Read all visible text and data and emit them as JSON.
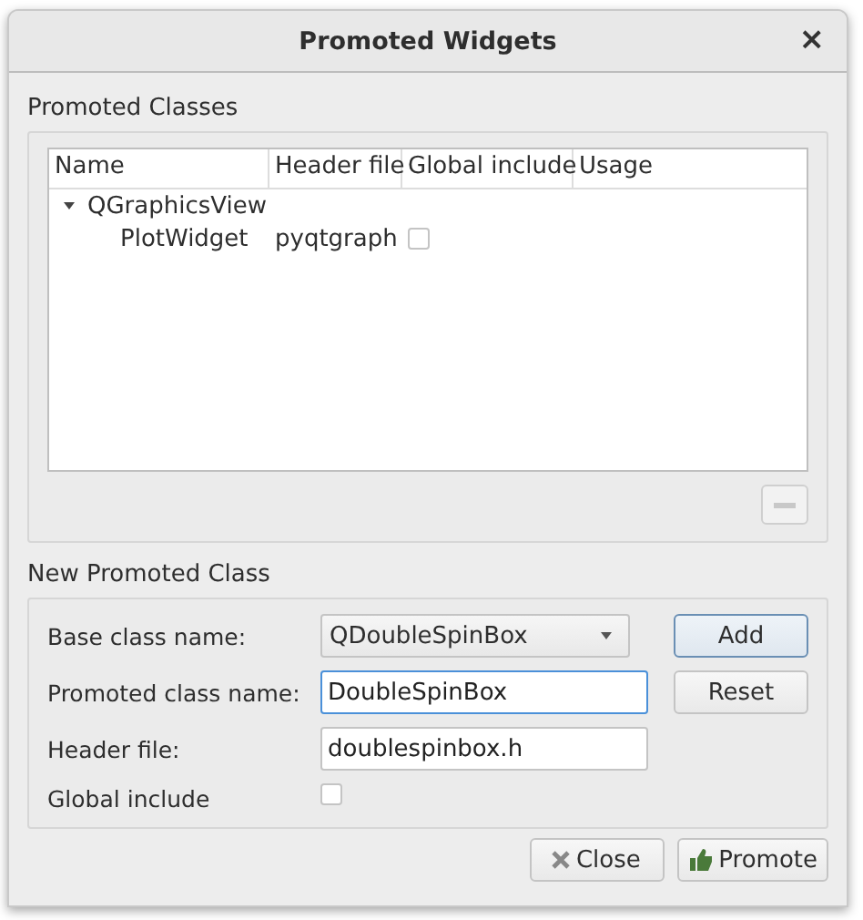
{
  "window": {
    "title": "Promoted Widgets",
    "close": "×"
  },
  "promoted_classes": {
    "title": "Promoted Classes",
    "columns": [
      "Name",
      "Header file",
      "Global include",
      "Usage"
    ],
    "tree": [
      {
        "name": "QGraphicsView",
        "expanded": true,
        "children": [
          {
            "name": "PlotWidget",
            "header_file": "pyqtgraph",
            "global_include": false
          }
        ]
      }
    ],
    "remove_button": {
      "disabled": true
    }
  },
  "new_promoted_class": {
    "title": "New Promoted Class",
    "base_class_label": "Base class name:",
    "base_class_value": "QDoubleSpinBox",
    "promoted_class_label": "Promoted class name:",
    "promoted_class_value": "DoubleSpinBox",
    "header_file_label": "Header file:",
    "header_file_value": "doublespinbox.h",
    "global_include_label": "Global include",
    "global_include": false,
    "buttons": [
      "Add",
      "Reset"
    ]
  },
  "buttons": [
    "Close",
    "Promote"
  ]
}
